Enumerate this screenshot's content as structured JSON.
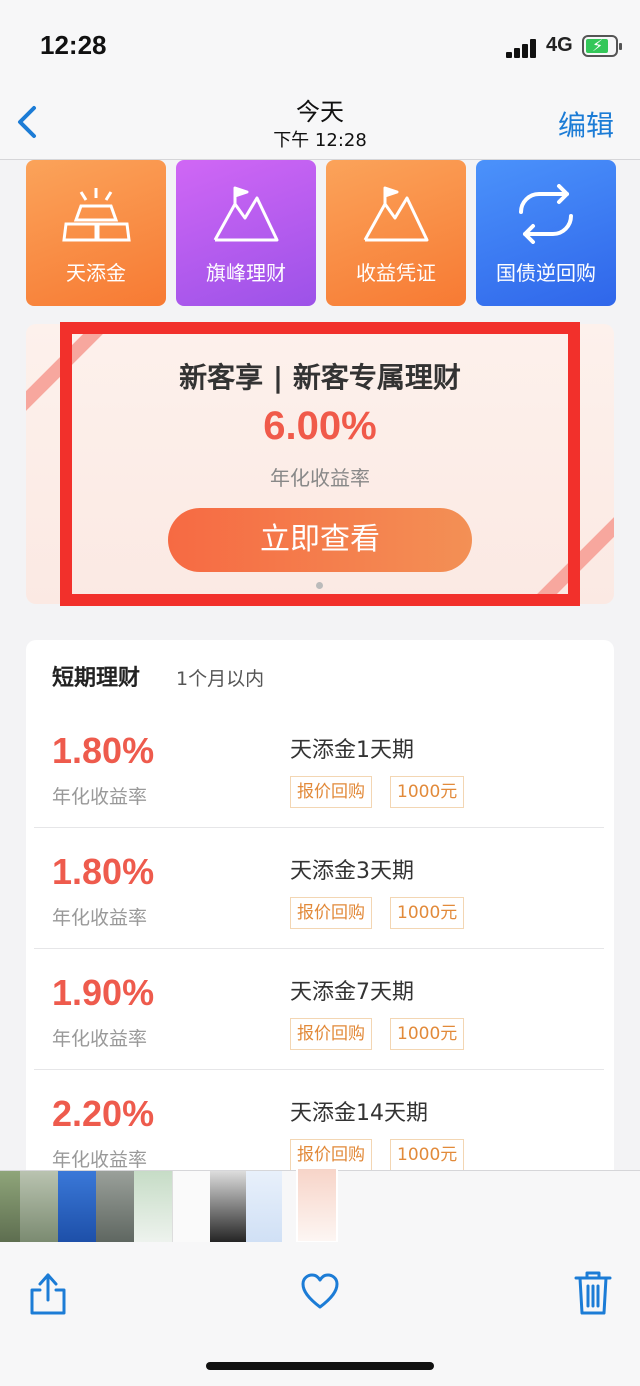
{
  "status_bar": {
    "time": "12:28",
    "network": "4G"
  },
  "navbar": {
    "back_icon": "chevron-left-icon",
    "title": "今天",
    "subtitle": "下午 12:28",
    "edit_label": "编辑"
  },
  "tiles": [
    {
      "label": "天添金",
      "icon": "gold-bars-icon",
      "color": "#f98a3c"
    },
    {
      "label": "旗峰理财",
      "icon": "mountain-flag-icon",
      "color": "#b25df0"
    },
    {
      "label": "收益凭证",
      "icon": "mountain-flag-icon",
      "color": "#f98a3c"
    },
    {
      "label": "国债逆回购",
      "icon": "refresh-arrows-icon",
      "color": "#3f7ef5"
    }
  ],
  "banner": {
    "title": "新客享 | 新客专属理财",
    "rate": "6.00%",
    "rate_label": "年化收益率",
    "button_label": "立即查看"
  },
  "short_term": {
    "title": "短期理财",
    "subtitle": "1个月以内",
    "products": [
      {
        "rate": "1.80%",
        "rate_label": "年化收益率",
        "name": "天添金1天期",
        "tag1": "报价回购",
        "tag2": "1000元"
      },
      {
        "rate": "1.80%",
        "rate_label": "年化收益率",
        "name": "天添金3天期",
        "tag1": "报价回购",
        "tag2": "1000元"
      },
      {
        "rate": "1.90%",
        "rate_label": "年化收益率",
        "name": "天添金7天期",
        "tag1": "报价回购",
        "tag2": "1000元"
      },
      {
        "rate": "2.20%",
        "rate_label": "年化收益率",
        "name": "天添金14天期",
        "tag1": "报价回购",
        "tag2": "1000元"
      }
    ]
  },
  "toolbar": {
    "share_icon": "share-icon",
    "favorite_icon": "heart-icon",
    "delete_icon": "trash-icon"
  }
}
